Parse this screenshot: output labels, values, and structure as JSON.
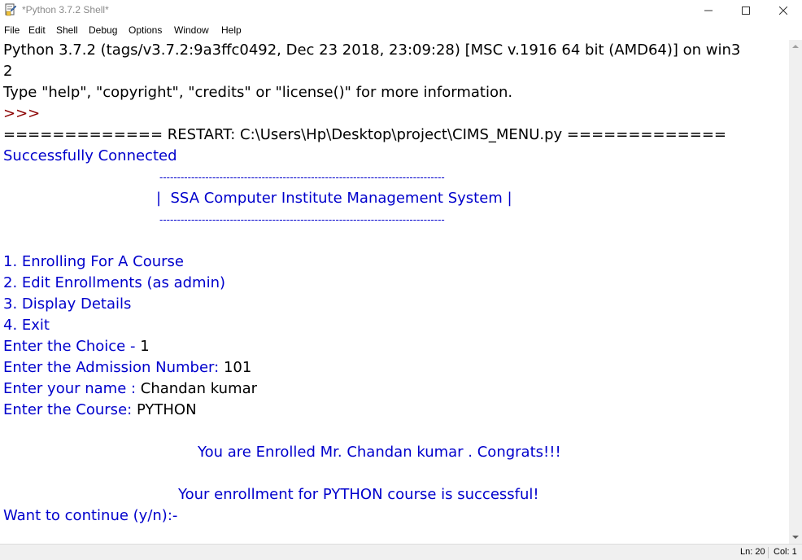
{
  "window": {
    "title": "*Python 3.7.2 Shell*"
  },
  "menu": {
    "items": [
      "File",
      "Edit",
      "Shell",
      "Debug",
      "Options",
      "Window",
      "Help"
    ]
  },
  "shell": {
    "banner_line1": "Python 3.7.2 (tags/v3.7.2:9a3ffc0492, Dec 23 2018, 23:09:28) [MSC v.1916 64 bit (AMD64)] on win3",
    "banner_line2": "2",
    "banner_line3": "Type \"help\", \"copyright\", \"credits\" or \"license()\" for more information.",
    "prompt": ">>>",
    "restart_line": "============= RESTART: C:\\Users\\Hp\\Desktop\\project\\CIMS_MENU.py =============",
    "connected": "Successfully Connected",
    "rule_top": "---------------------------------------------------------------------------------",
    "heading": "|  SSA Computer Institute Management System |",
    "rule_bottom": "---------------------------------------------------------------------------------",
    "options": [
      "1. Enrolling For A Course",
      "2. Edit Enrollments (as admin)",
      "3. Display Details",
      "4. Exit"
    ],
    "choice_label": "Enter the Choice - ",
    "choice_value": "1",
    "admission_label": "Enter the Admission Number: ",
    "admission_value": "101",
    "name_label": "Enter your name : ",
    "name_value": "Chandan kumar",
    "course_label": "Enter the Course: ",
    "course_value": "PYTHON",
    "enrolled_msg": "You are Enrolled Mr. Chandan kumar . Congrats!!!",
    "success_msg": "Your enrollment for PYTHON course is successful!",
    "continue_prompt": "Want to continue (y/n):-"
  },
  "status": {
    "line": "Ln: 20",
    "col": "Col: 1"
  }
}
